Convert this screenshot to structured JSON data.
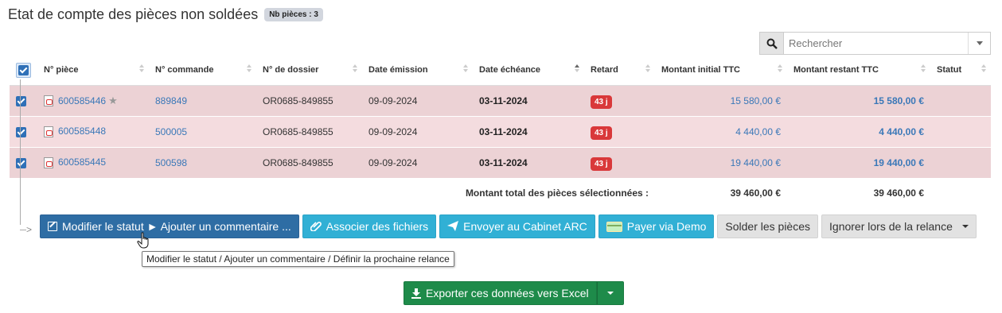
{
  "page": {
    "title": "Etat de compte des pièces non soldées",
    "count_badge": "Nb pièces : 3"
  },
  "search": {
    "placeholder": "Rechercher",
    "value": ""
  },
  "table": {
    "columns": [
      "N° pièce",
      "N° commande",
      "N° de dossier",
      "Date émission",
      "Date échéance",
      "Retard",
      "Montant initial TTC",
      "Montant restant TTC",
      "Statut"
    ],
    "sorted_column": "Date échéance",
    "all_selected": true,
    "rows": [
      {
        "selected": true,
        "piece": "600585446",
        "starred": true,
        "commande": "889849",
        "dossier": "OR0685-849855",
        "emission": "09-09-2024",
        "echeance": "03-11-2024",
        "retard": "43 j",
        "initial": "15 580,00 €",
        "restant": "15 580,00 €",
        "statut": ""
      },
      {
        "selected": true,
        "piece": "600585448",
        "starred": false,
        "commande": "500005",
        "dossier": "OR0685-849855",
        "emission": "09-09-2024",
        "echeance": "03-11-2024",
        "retard": "43 j",
        "initial": "4 440,00 €",
        "restant": "4 440,00 €",
        "statut": ""
      },
      {
        "selected": true,
        "piece": "600585445",
        "starred": false,
        "commande": "500598",
        "dossier": "OR0685-849855",
        "emission": "09-09-2024",
        "echeance": "03-11-2024",
        "retard": "43 j",
        "initial": "19 440,00 €",
        "restant": "19 440,00 €",
        "statut": ""
      }
    ],
    "total_label": "Montant total des pièces sélectionnées :",
    "total_initial": "39 460,00 €",
    "total_restant": "39 460,00 €"
  },
  "actions": {
    "modify": "Modifier le statut ► Ajouter un commentaire ...",
    "associate": "Associer des fichiers",
    "send": "Envoyer au Cabinet ARC",
    "pay": "Payer via Demo",
    "settle": "Solder les pièces",
    "ignore": "Ignorer lors de la relance"
  },
  "tooltip": "Modifier le statut / Ajouter un commentaire / Définir la prochaine relance",
  "export": {
    "label": "Exporter ces données vers Excel"
  },
  "colors": {
    "primary": "#2e6da4",
    "info": "#31b0d5",
    "success": "#1e8b4a",
    "danger": "#d9383a",
    "row_a": "#ecd2d5",
    "row_b": "#f4dcdf",
    "link": "#3a78b8"
  },
  "icons": {
    "search": "search-icon",
    "pdf": "pdf-icon",
    "star": "star-icon",
    "edit": "edit-icon",
    "paperclip": "paperclip-icon",
    "send": "paper-plane-icon",
    "card": "credit-card-icon",
    "download": "download-icon",
    "cursor": "hand-pointer-icon"
  }
}
